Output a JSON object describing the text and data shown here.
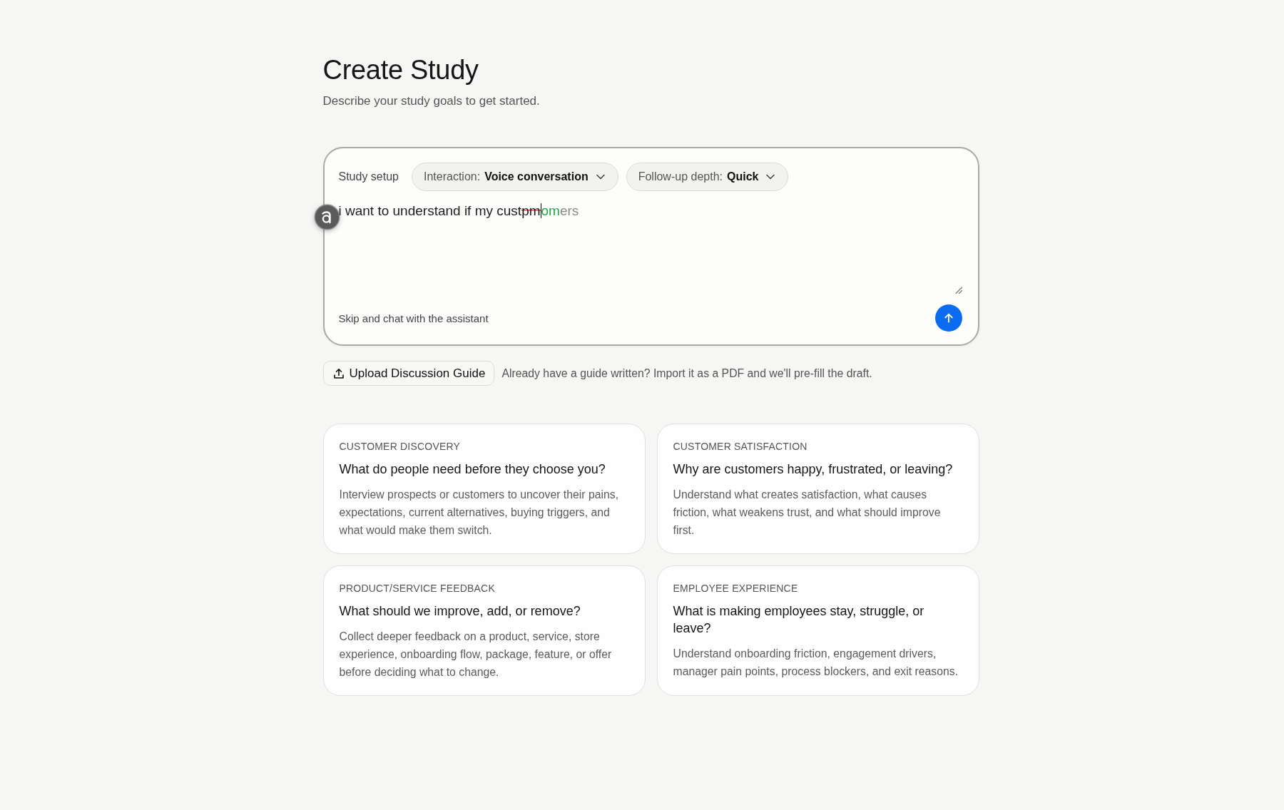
{
  "page": {
    "title": "Create Study",
    "subtitle": "Describe your study goals to get started."
  },
  "setup": {
    "label": "Study setup",
    "dropdowns": [
      {
        "label": "Interaction:",
        "value": "Voice conversation"
      },
      {
        "label": "Follow-up depth:",
        "value": "Quick"
      }
    ],
    "prompt": {
      "segments": [
        {
          "kind": "typed",
          "text": "i want to understand if my cust",
          "caret": false
        },
        {
          "kind": "deleted",
          "text": "pm",
          "caret": false
        },
        {
          "kind": "inserted",
          "text": "om",
          "caret": true
        },
        {
          "kind": "completion",
          "text": "ers",
          "caret": false
        }
      ]
    },
    "skip_link": "Skip and chat with the assistant"
  },
  "upload": {
    "button": "Upload Discussion Guide",
    "hint": "Already have a guide written? Import it as a PDF and we'll pre-fill the draft."
  },
  "templates": [
    {
      "category": "CUSTOMER DISCOVERY",
      "title": "What do people need before they choose you?",
      "description": "Interview prospects or customers to uncover their pains, expectations, current alternatives, buying triggers, and what would make them switch."
    },
    {
      "category": "CUSTOMER SATISFACTION",
      "title": "Why are customers happy, frustrated, or leaving?",
      "description": "Understand what creates satisfaction, what causes friction, what weakens trust, and what should improve first."
    },
    {
      "category": "PRODUCT/SERVICE FEEDBACK",
      "title": "What should we improve, add, or remove?",
      "description": "Collect deeper feedback on a product, service, store experience, onboarding flow, package, feature, or offer before deciding what to change."
    },
    {
      "category": "EMPLOYEE EXPERIENCE",
      "title": "What is making employees stay, struggle, or leave?",
      "description": "Understand onboarding friction, engagement drivers, manager pain points, process blockers, and exit reasons."
    }
  ]
}
